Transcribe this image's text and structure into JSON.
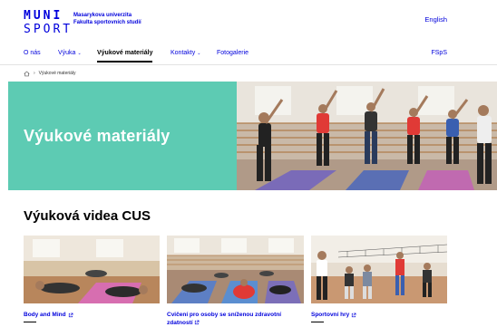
{
  "header": {
    "logo_line1": "MUNI",
    "logo_line2": "SPORT",
    "university_line1": "Masarykova univerzita",
    "university_line2": "Fakulta sportovních studií",
    "language_link": "English"
  },
  "nav": {
    "items": [
      {
        "label": "O nás",
        "has_dropdown": false,
        "active": false
      },
      {
        "label": "Výuka",
        "has_dropdown": true,
        "active": false
      },
      {
        "label": "Výukové materiály",
        "has_dropdown": false,
        "active": true
      },
      {
        "label": "Kontakty",
        "has_dropdown": true,
        "active": false
      },
      {
        "label": "Fotogalerie",
        "has_dropdown": false,
        "active": false
      }
    ],
    "right_link": "FSpS"
  },
  "breadcrumb": {
    "current": "Výukové materiály"
  },
  "hero": {
    "title": "Výukové materiály",
    "panel_color": "#5dcbb3"
  },
  "section": {
    "title": "Výuková videa CUS"
  },
  "cards": [
    {
      "title_line1": "Body and Mind",
      "title_line2": ""
    },
    {
      "title_line1": "Cvičení pro osoby se sníženou zdravotní",
      "title_line2": "zdatností"
    },
    {
      "title_line1": "Sportovní hry",
      "title_line2": ""
    }
  ],
  "colors": {
    "link": "#0000dc",
    "hero": "#5dcbb3"
  }
}
